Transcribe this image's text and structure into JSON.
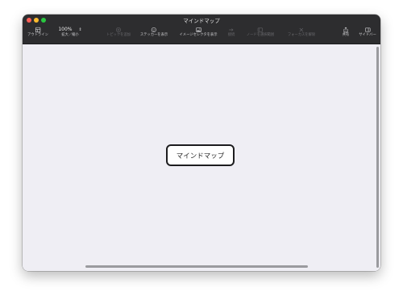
{
  "window": {
    "title": "マインドマップ"
  },
  "toolbar": {
    "outline": {
      "label": "アウトライン",
      "icon": "outline-icon"
    },
    "zoom": {
      "value": "100%",
      "label": "拡大／縮小",
      "icon": "stepper-icon"
    },
    "add_topic": {
      "label": "トピックを追加",
      "icon": "add-topic-icon",
      "enabled": false
    },
    "stickers": {
      "label": "ステッカーを表示",
      "icon": "sticker-icon"
    },
    "images": {
      "label": "イメージセレクタを表示",
      "icon": "image-icon"
    },
    "connect": {
      "label": "接続",
      "icon": "connect-icon",
      "enabled": false
    },
    "select_nodes": {
      "label": "ノードを選択範囲",
      "icon": "select-nodes-icon",
      "enabled": false
    },
    "focus_release": {
      "label": "フォーカスを解除",
      "icon": "focus-release-icon",
      "enabled": false
    },
    "share": {
      "label": "共有",
      "icon": "share-icon"
    },
    "sidebar": {
      "label": "サイドバー",
      "icon": "sidebar-icon"
    }
  },
  "canvas": {
    "central_node": "マインドマップ"
  },
  "colors": {
    "toolbar_bg": "#2d2d2f",
    "canvas_bg": "#efeef4",
    "close": "#ff5f57",
    "minimize": "#febc2e",
    "zoom": "#28c840"
  }
}
